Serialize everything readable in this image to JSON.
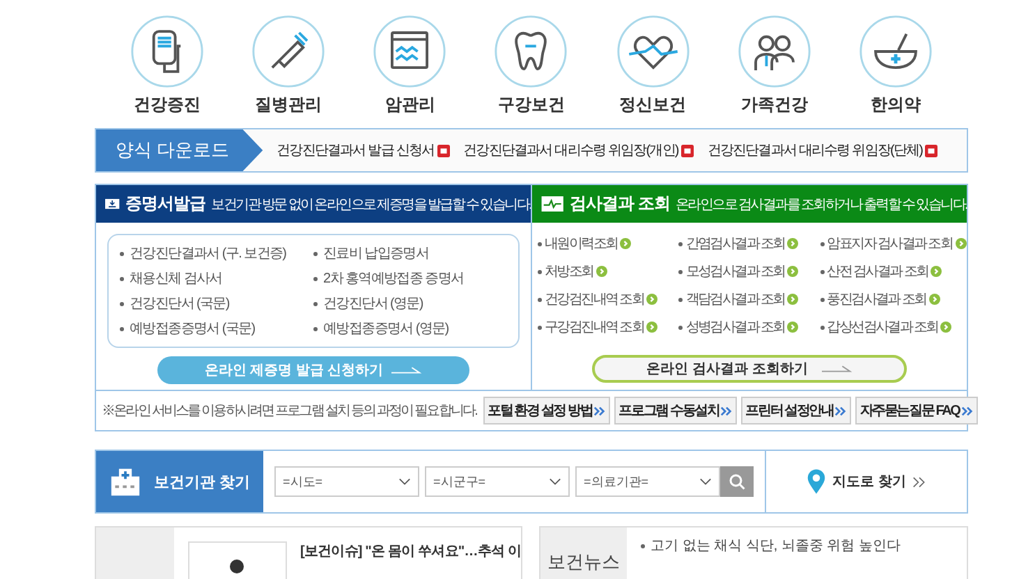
{
  "categories": [
    {
      "kind": "iv",
      "label": "건강증진"
    },
    {
      "kind": "syringe",
      "label": "질병관리"
    },
    {
      "kind": "monitor",
      "label": "암관리"
    },
    {
      "kind": "tooth",
      "label": "구강보건"
    },
    {
      "kind": "heart",
      "label": "정신보건"
    },
    {
      "kind": "family",
      "label": "가족건강"
    },
    {
      "kind": "mortar",
      "label": "한의약"
    }
  ],
  "download": {
    "title": "양식 다운로드",
    "links": [
      "건강진단결과서 발급 신청서",
      "건강진단결과서 대리수령 위임장(개인)",
      "건강진단결과서 대리수령 위임장(단체)"
    ]
  },
  "certificate": {
    "title": "증명서발급",
    "desc": "보건기관 방문 없이 온라인으로 제증명을 발급할 수 있습니다.",
    "items": [
      "건강진단결과서 (구. 보건증)",
      "진료비 납입증명서",
      "채용신체 검사서",
      "2차 홍역예방접종 증명서",
      "건강진단서 (국문)",
      "건강진단서 (영문)",
      "예방접종증명서 (국문)",
      "예방접종증명서 (영문)"
    ],
    "button": "온라인 제증명 발급 신청하기"
  },
  "results": {
    "title": "검사결과 조회",
    "desc": "온라인으로 검사결과를 조회하거나 출력할 수 있습니다.",
    "items": [
      "내원이력조회",
      "간염검사결과 조회",
      "암표지자 검사결과 조회",
      "처방조회",
      "모성검사결과 조회",
      "산전 검사결과 조회",
      "건강검진내역 조회",
      "객담검사결과 조회",
      "풍진검사결과 조회",
      "구강검진내역 조회",
      "성병검사결과 조회",
      "갑상선검사결과 조회"
    ],
    "button": "온라인 검사결과 조회하기"
  },
  "notice": {
    "text": "※온라인 서비스를 이용하시려면 프로그램 설치 등의 과정이 필요합니다.",
    "buttons": [
      "포털 환경 설정 방법",
      "프로그램 수동설치",
      "프린터 설정안내",
      "자주묻는질문 FAQ"
    ]
  },
  "finder": {
    "title": "보건기관 찾기",
    "selects": [
      {
        "value": "=시도="
      },
      {
        "value": "=시군구="
      },
      {
        "value": "=의료기관="
      }
    ],
    "map_link": "지도로 찾기"
  },
  "issue": {
    "lines": [
      "[보건이슈] \"온 몸이 쑤셔요\"…추석 이"
    ]
  },
  "news": {
    "title": "보건뉴스",
    "items": [
      "고기 없는 채식 식단, 뇌졸중 위험 높인다"
    ]
  }
}
